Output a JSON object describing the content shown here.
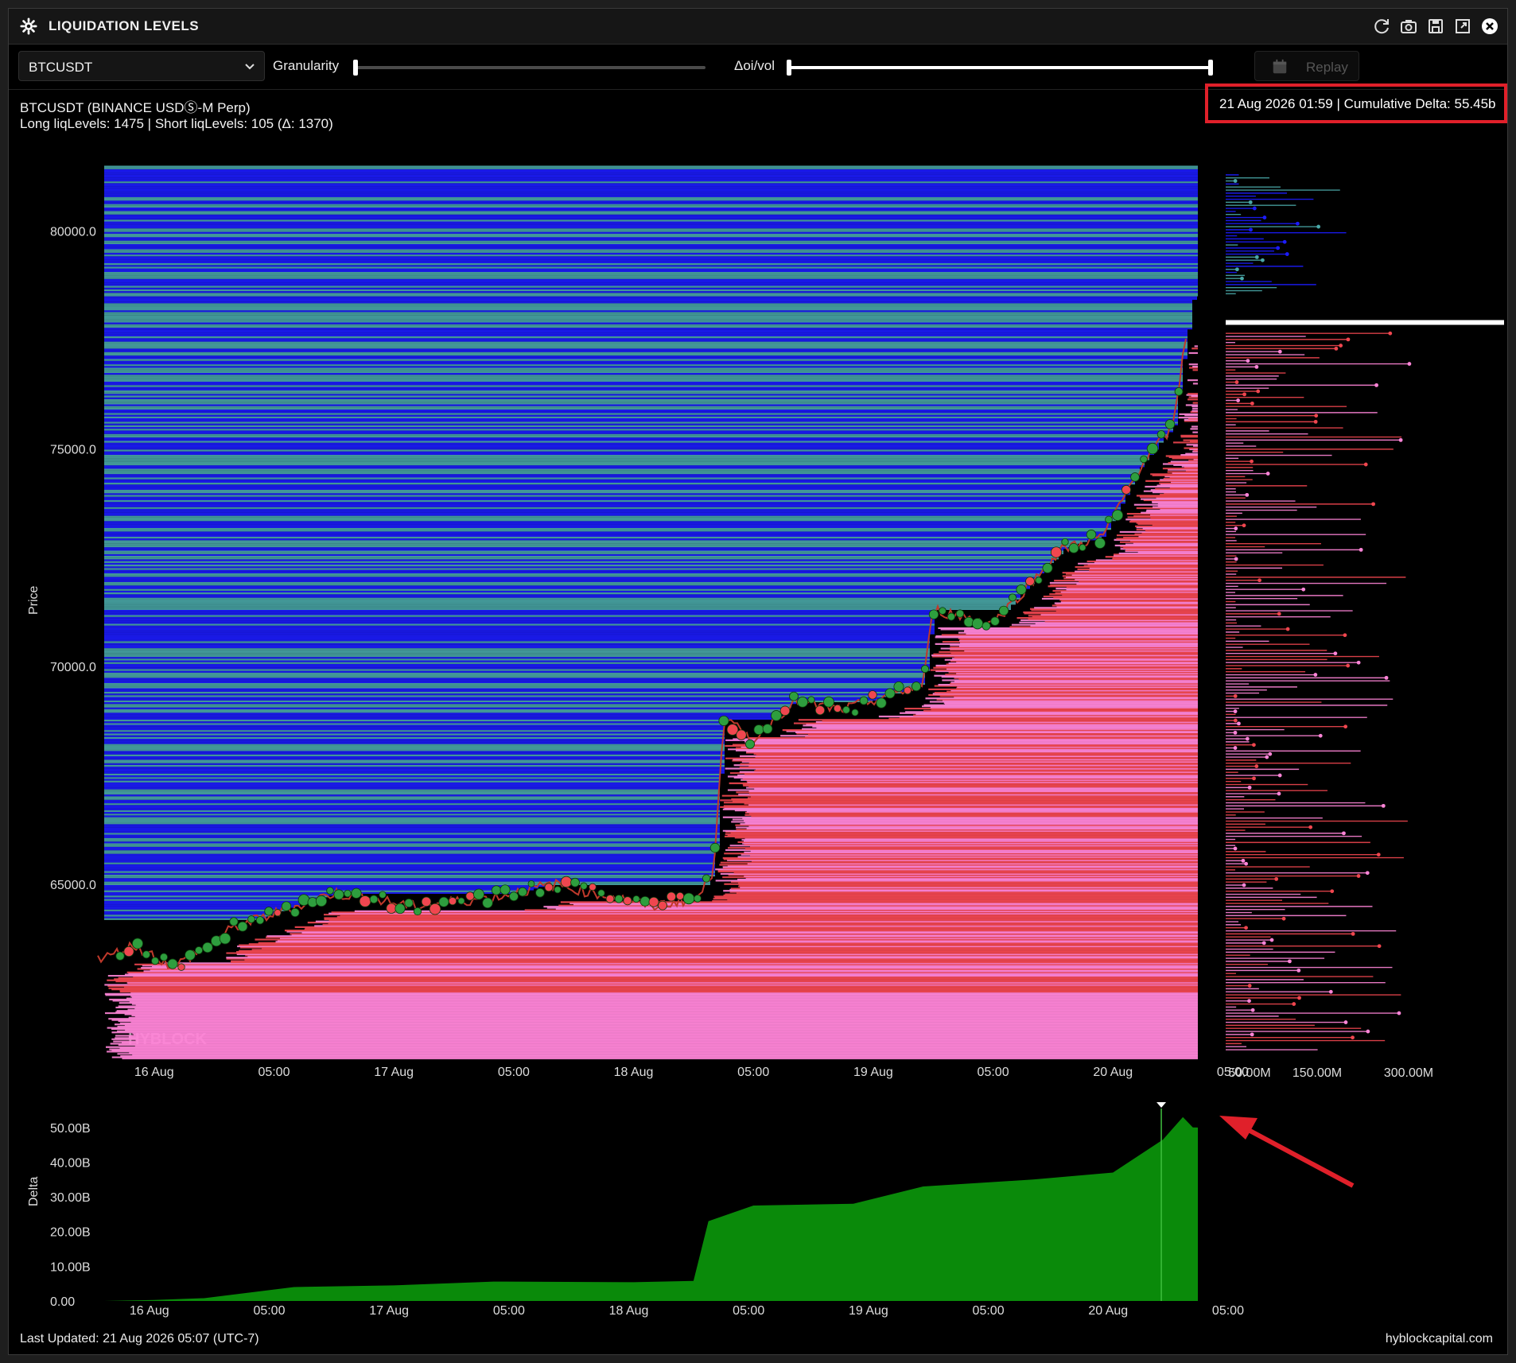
{
  "window": {
    "title": "LIQUIDATION LEVELS"
  },
  "toolbar": {
    "symbol": "BTCUSDT",
    "granularity_label": "Granularity",
    "ratio_label": "Δoi/vol",
    "replay_label": "Replay"
  },
  "info": {
    "line1": "BTCUSDT (BINANCE USDⓈ-M Perp)",
    "line2": "Long liqLevels: 1475 | Short liqLevels: 105 (Δ: 1370)",
    "highlight": "21 Aug 2026 01:59 | Cumulative Delta: 55.45b"
  },
  "watermark": "HYBLOCK",
  "footer": {
    "last_updated": "Last Updated: 21 Aug 2026 05:07 (UTC-7)",
    "site": "hyblockcapital.com"
  },
  "colors": {
    "long_pink": "#ff85d8",
    "long_red": "#f0464f",
    "short_blue": "#1c1cff",
    "short_teal": "#4aa8a8",
    "price_green": "#2e9e3e",
    "delta_green": "#0a8a0a",
    "highlight_red": "#e0202a"
  },
  "chart_data": [
    {
      "type": "scatter",
      "title": "",
      "ylabel": "Price",
      "y_ticks": [
        "80000.0",
        "75000.0",
        "70000.0",
        "65000.0"
      ],
      "y_tick_values": [
        80000,
        75000,
        70000,
        65000
      ],
      "x_ticks": [
        "16 Aug",
        "05:00",
        "17 Aug",
        "05:00",
        "18 Aug",
        "05:00",
        "19 Aug",
        "05:00",
        "20 Aug",
        "05:00"
      ],
      "ylim": [
        61000,
        82000
      ],
      "price_path": {
        "x": [
          "15 Aug 19:00",
          "15 Aug 22:00",
          "16 Aug 02:00",
          "16 Aug 08:00",
          "16 Aug 13:00",
          "16 Aug 18:00",
          "17 Aug 02:00",
          "17 Aug 10:00",
          "17 Aug 16:00",
          "17 Aug 22:00",
          "18 Aug 02:00",
          "18 Aug 06:30",
          "18 Aug 08:00",
          "18 Aug 09:00",
          "18 Aug 12:00",
          "18 Aug 16:00",
          "18 Aug 21:00",
          "19 Aug 05:00",
          "19 Aug 06:00",
          "19 Aug 12:00",
          "19 Aug 19:00",
          "19 Aug 23:00",
          "20 Aug 03:00",
          "20 Aug 06:00",
          "20 Aug 07:00",
          "20 Aug 08:00"
        ],
        "y": [
          63300,
          63600,
          63100,
          64000,
          64400,
          64800,
          64500,
          64700,
          65000,
          64700,
          64500,
          64700,
          65300,
          68800,
          68300,
          69200,
          69000,
          69600,
          71300,
          71000,
          72700,
          73000,
          74700,
          75500,
          77100,
          78500
        ]
      },
      "long_levels_range": [
        61000,
        77500
      ],
      "short_levels_range": [
        64200,
        81500
      ],
      "series": [
        {
          "name": "Long liqLevels",
          "count": 1475
        },
        {
          "name": "Short liqLevels",
          "count": 105
        }
      ]
    },
    {
      "type": "bar",
      "title": "",
      "xlabel": "",
      "x_ticks": [
        "50.00M",
        "150.00M",
        "300.00M"
      ]
    },
    {
      "type": "area",
      "title": "",
      "ylabel": "Delta",
      "y_ticks": [
        "50.00B",
        "40.00B",
        "30.00B",
        "20.00B",
        "10.00B",
        "0.00"
      ],
      "x_ticks": [
        "16 Aug",
        "05:00",
        "17 Aug",
        "05:00",
        "18 Aug",
        "05:00",
        "19 Aug",
        "05:00",
        "20 Aug",
        "05:00"
      ],
      "ylim": [
        0,
        55
      ],
      "x": [
        "16 Aug 00:00",
        "16 Aug 05:00",
        "16 Aug 14:00",
        "17 Aug 00:00",
        "17 Aug 10:00",
        "18 Aug 00:00",
        "18 Aug 06:00",
        "18 Aug 07:30",
        "18 Aug 12:00",
        "18 Aug 22:00",
        "19 Aug 05:00",
        "19 Aug 16:00",
        "20 Aug 00:00",
        "20 Aug 05:00",
        "20 Aug 07:00",
        "20 Aug 08:00"
      ],
      "values": [
        0.3,
        0.8,
        4.0,
        4.5,
        5.6,
        5.4,
        5.8,
        23.0,
        27.5,
        28.0,
        33.0,
        35.0,
        37.0,
        46.5,
        53.0,
        50.0
      ],
      "marker": {
        "label": "21 Aug 2026 01:59",
        "value": 55.45
      }
    }
  ]
}
